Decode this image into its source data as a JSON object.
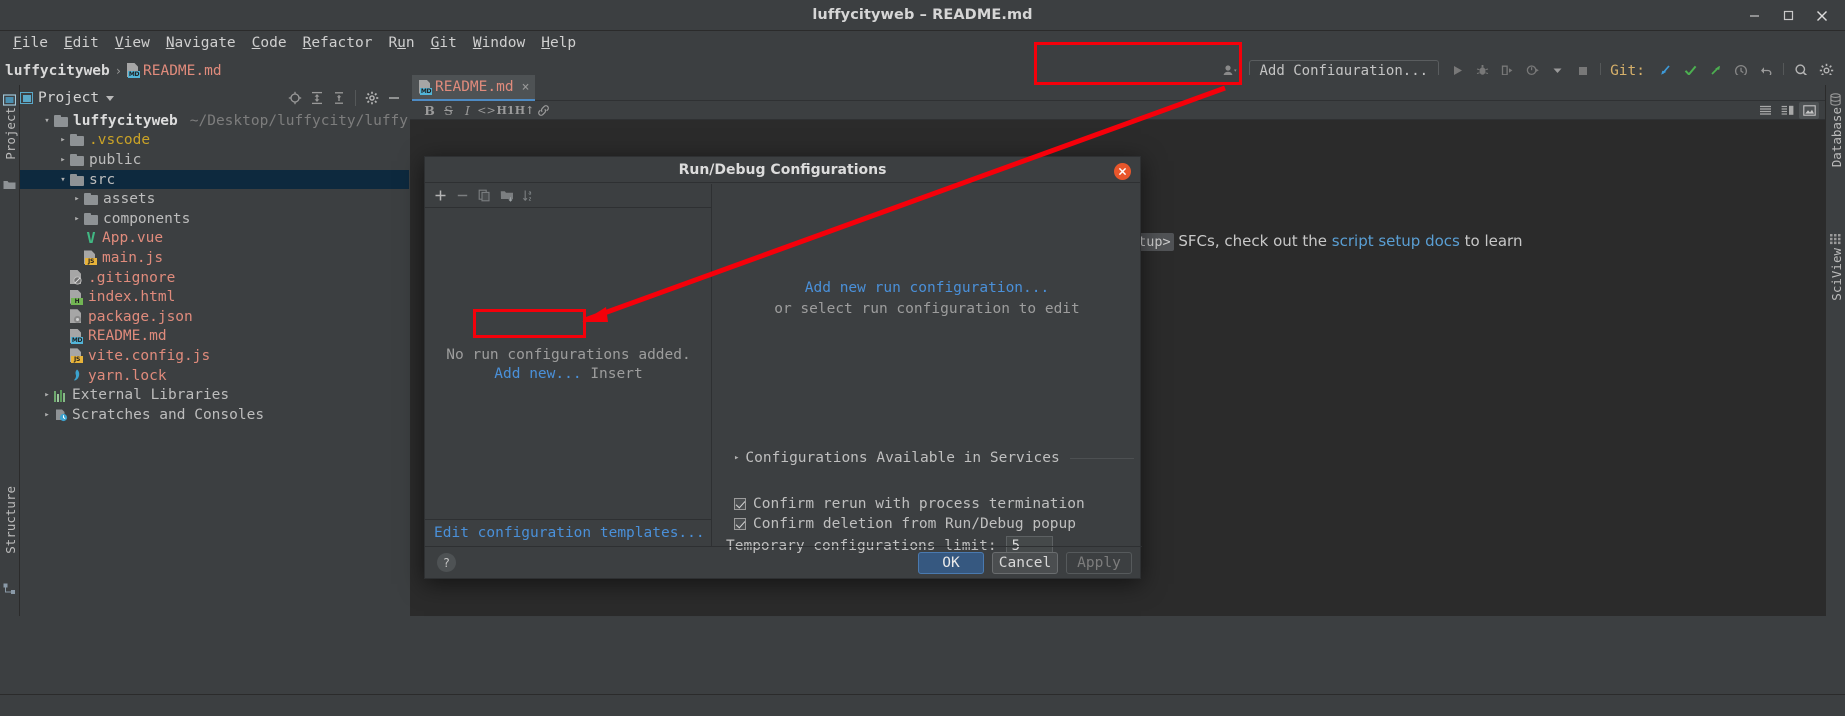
{
  "window": {
    "title": "luffycityweb – README.md",
    "controls": [
      "minimize",
      "maximize",
      "close"
    ]
  },
  "menubar": {
    "items": [
      {
        "label": "File",
        "mnemonic": "F"
      },
      {
        "label": "Edit",
        "mnemonic": "E"
      },
      {
        "label": "View",
        "mnemonic": "V"
      },
      {
        "label": "Navigate",
        "mnemonic": "N"
      },
      {
        "label": "Code",
        "mnemonic": "C"
      },
      {
        "label": "Refactor",
        "mnemonic": "R"
      },
      {
        "label": "Run",
        "mnemonic": "u"
      },
      {
        "label": "Git",
        "mnemonic": "G"
      },
      {
        "label": "Window",
        "mnemonic": "W"
      },
      {
        "label": "Help",
        "mnemonic": "H"
      }
    ]
  },
  "navbar": {
    "breadcrumb": {
      "project": "luffycityweb",
      "separator": "›",
      "file": "README.md"
    },
    "run_toolbar": {
      "config_button": "Add Configuration...",
      "git_label": "Git:",
      "icons": [
        "user-avatar-icon",
        "run-icon",
        "debug-icon",
        "coverage-icon",
        "profile-icon",
        "dropdown-caret-icon",
        "stop-icon",
        "git-update-icon",
        "git-commit-icon",
        "git-push-icon",
        "history-icon",
        "rollback-icon",
        "search-everywhere-icon",
        "settings-icon"
      ]
    }
  },
  "project_panel": {
    "title": "Project",
    "header_icons": [
      "locate-icon",
      "expand-all-icon",
      "collapse-all-icon",
      "settings-icon",
      "hide-icon"
    ],
    "tree": [
      {
        "label": "luffycityweb",
        "path": "~/Desktop/luffycity/luffycit",
        "type": "project-root",
        "indent": 0,
        "arrow": "expanded",
        "bold": true
      },
      {
        "label": ".vscode",
        "type": "folder",
        "indent": 1,
        "arrow": "collapsed",
        "color": "yellow"
      },
      {
        "label": "public",
        "type": "folder",
        "indent": 1,
        "arrow": "collapsed",
        "color": "normal"
      },
      {
        "label": "src",
        "type": "folder",
        "indent": 1,
        "arrow": "expanded",
        "color": "normal",
        "selected": true
      },
      {
        "label": "assets",
        "type": "folder",
        "indent": 2,
        "arrow": "collapsed",
        "color": "normal"
      },
      {
        "label": "components",
        "type": "folder",
        "indent": 2,
        "arrow": "collapsed",
        "color": "normal"
      },
      {
        "label": "App.vue",
        "type": "vue-file",
        "indent": 2,
        "arrow": "none",
        "color": "red"
      },
      {
        "label": "main.js",
        "type": "js-file",
        "indent": 2,
        "arrow": "none",
        "color": "red"
      },
      {
        "label": ".gitignore",
        "type": "gitignore-file",
        "indent": 1,
        "arrow": "none",
        "color": "red"
      },
      {
        "label": "index.html",
        "type": "html-file",
        "indent": 1,
        "arrow": "none",
        "color": "red"
      },
      {
        "label": "package.json",
        "type": "json-file",
        "indent": 1,
        "arrow": "none",
        "color": "red"
      },
      {
        "label": "README.md",
        "type": "md-file",
        "indent": 1,
        "arrow": "none",
        "color": "red"
      },
      {
        "label": "vite.config.js",
        "type": "js-file",
        "indent": 1,
        "arrow": "none",
        "color": "red"
      },
      {
        "label": "yarn.lock",
        "type": "yarn-file",
        "indent": 1,
        "arrow": "none",
        "color": "red"
      },
      {
        "label": "External Libraries",
        "type": "libraries",
        "indent": 0,
        "arrow": "collapsed",
        "color": "normal"
      },
      {
        "label": "Scratches and Consoles",
        "type": "scratches",
        "indent": 0,
        "arrow": "collapsed",
        "color": "normal"
      }
    ]
  },
  "left_strip": {
    "items": [
      {
        "label": "Project",
        "icon": "project-icon"
      },
      {
        "label": "Structure",
        "icon": "structure-icon"
      }
    ]
  },
  "right_strip": {
    "items": [
      {
        "label": "Database",
        "icon": "database-icon"
      },
      {
        "label": "SciView",
        "icon": "sciview-icon"
      }
    ]
  },
  "editor": {
    "tab": {
      "label": "README.md",
      "close": "×"
    },
    "markdown_toolbar": [
      "bold-icon",
      "strikethrough-icon",
      "italic-icon",
      "code-icon",
      "heading1-icon",
      "heading2-icon",
      "link-icon"
    ],
    "view_modes": [
      "editor-only-icon",
      "editor-and-preview-icon",
      "preview-only-icon",
      "split-layout-icon"
    ],
    "preview_snippet": {
      "code": "etup>",
      "text_before": " SFCs, check out the ",
      "link": "script setup docs",
      "text_after": " to learn"
    }
  },
  "dialog": {
    "title": "Run/Debug Configurations",
    "close_label": "×",
    "left_toolbar": [
      "add-icon",
      "remove-icon",
      "copy-icon",
      "move-into-folder-icon",
      "sort-alphabetically-icon"
    ],
    "empty_message": "No run configurations added.",
    "add_new_link": "Add new...",
    "insert_hint": "Insert",
    "edit_templates_link": "Edit configuration templates...",
    "right_panel": {
      "primary_link": "Add new run configuration...",
      "secondary_text": "or select run configuration to edit",
      "section_label": "Configurations Available in Services",
      "checkboxes": [
        {
          "label": "Confirm rerun with process termination",
          "checked": true
        },
        {
          "label": "Confirm deletion from Run/Debug popup",
          "checked": true
        }
      ],
      "limit_label": "Temporary configurations limit:",
      "limit_value": "5"
    },
    "buttons": {
      "help": "?",
      "ok": "OK",
      "cancel": "Cancel",
      "apply": "Apply"
    }
  },
  "annotations": {
    "color": "#f5000a",
    "boxes": [
      "add-configuration-button",
      "add-new-link"
    ],
    "arrow": {
      "from": "add-configuration-button",
      "to": "add-new-link"
    }
  },
  "colors": {
    "background": "#3c3f41",
    "editor_background": "#2b2b2b",
    "selection": "#0d293e",
    "link": "#4a90d9",
    "file_red": "#e08b7c",
    "annotation_red": "#f5000a",
    "ok_button": "#365880"
  }
}
